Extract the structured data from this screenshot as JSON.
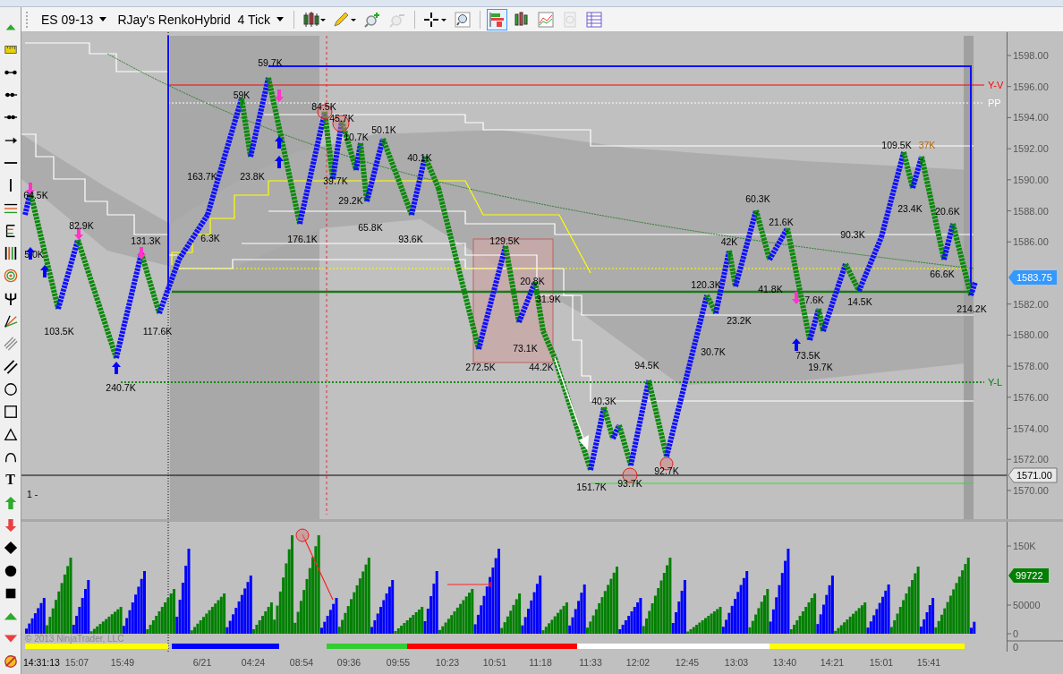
{
  "toolbar": {
    "instrument": "ES 09-13",
    "chart_type": "RJay's RenkoHybrid  4 Tick",
    "zoom_out_disabled": true,
    "view_buttons": [
      {
        "selected": true,
        "disabled": false
      },
      {
        "selected": false,
        "disabled": false
      },
      {
        "selected": false,
        "disabled": false
      },
      {
        "selected": false,
        "disabled": true
      },
      {
        "selected": false,
        "disabled": false
      }
    ]
  },
  "drawing_tools": {
    "text_glyph": "T"
  },
  "price_chart": {
    "panel_label": "1 -",
    "swing_labels": [
      "64.5K",
      "5.0K",
      "82.9K",
      "103.5K",
      "240.7K",
      "131.3K",
      "117.6K",
      "163.7K",
      "6.3K",
      "59K",
      "59.7K",
      "23.8K",
      "176.1K",
      "84.5K",
      "45.7K",
      "10.7K",
      "50.1K",
      "39.7K",
      "29.2K",
      "65.8K",
      "40.1K",
      "93.6K",
      "129.5K",
      "20.8K",
      "31.9K",
      "272.5K",
      "73.1K",
      "44.2K",
      "40.3K",
      "94.5K",
      "151.7K",
      "93.7K",
      "92.7K",
      "120.3K",
      "42K",
      "60.3K",
      "21.6K",
      "41.8K",
      "23.2K",
      "30.7K",
      "7.6K",
      "73.5K",
      "19.7K",
      "90.3K",
      "14.5K",
      "109.5K",
      "23.4K",
      "20.6K",
      "66.6K",
      "214.2K"
    ],
    "session_high_label": "37K",
    "level_labels": [
      {
        "text": "Y-V",
        "color": "#ff0000"
      },
      {
        "text": "PP",
        "color": "#ffffff"
      },
      {
        "text": "Y-L",
        "color": "#008000"
      }
    ],
    "price_ticks": [
      "1598.00",
      "1596.00",
      "1594.00",
      "1592.00",
      "1590.00",
      "1588.00",
      "1586.00",
      "1582.00",
      "1580.00",
      "1578.00",
      "1576.00",
      "1574.00",
      "1572.00",
      "1570.00"
    ],
    "last_price": "1583.75",
    "cursor_price": "1571.00"
  },
  "volume_panel": {
    "ticks": [
      "150K",
      "50000",
      "0"
    ],
    "last_volume": "99722",
    "lower_tick": "0",
    "copyright": "© 2013 NinjaTrader, LLC"
  },
  "time_axis": {
    "current_time": "14:31:13",
    "ticks": [
      "15:07",
      "15:49",
      "6/21",
      "04:24",
      "08:54",
      "09:36",
      "09:55",
      "10:23",
      "10:51",
      "11:18",
      "11:33",
      "12:02",
      "12:45",
      "13:03",
      "13:40",
      "14:21",
      "15:01",
      "15:41"
    ]
  }
}
